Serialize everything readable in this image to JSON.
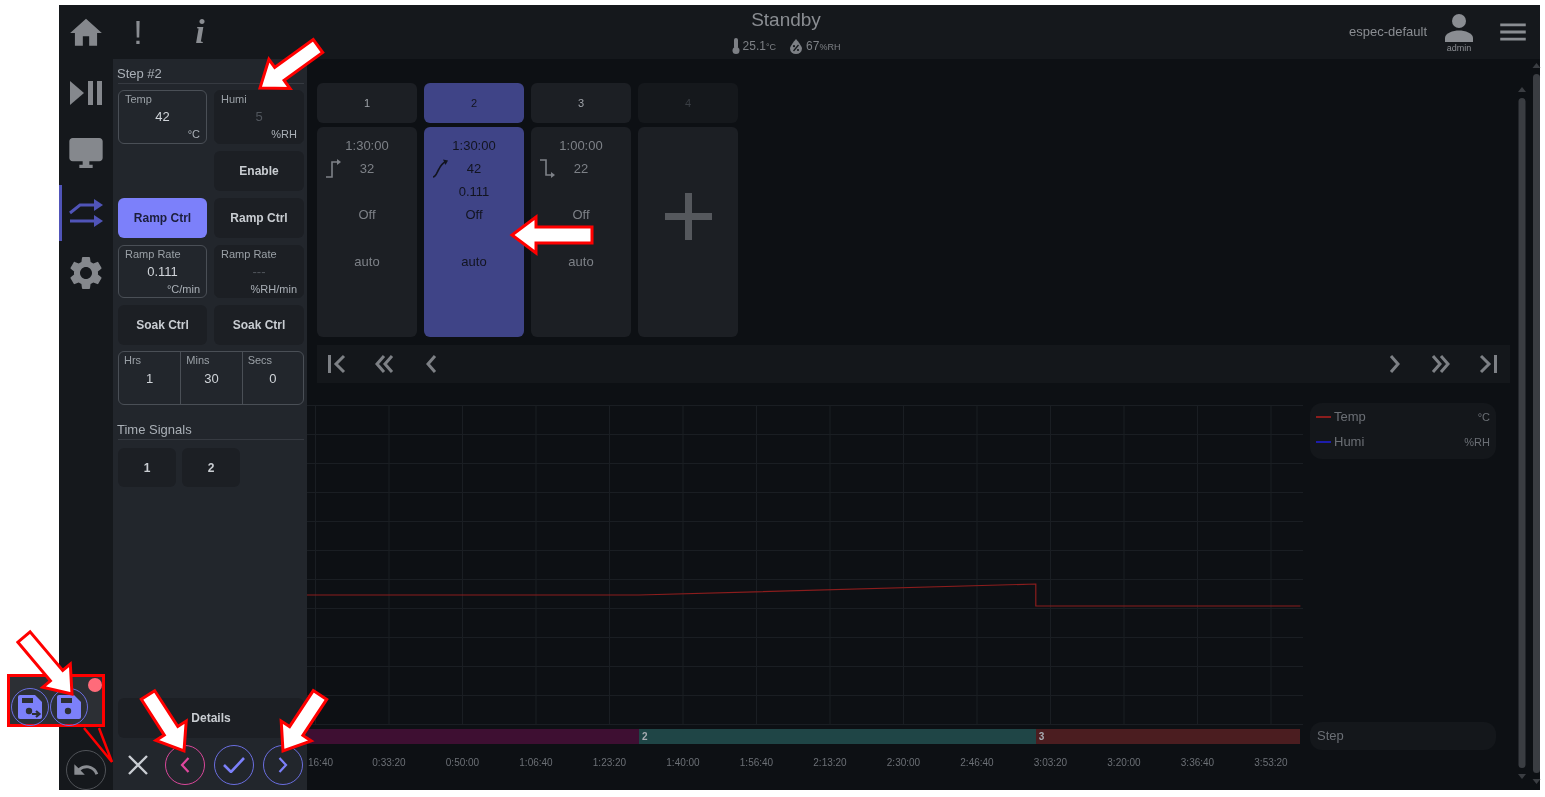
{
  "header": {
    "alerts_icon": "!",
    "info_icon": "i",
    "title": "Standby",
    "temperature": {
      "value": "25.1",
      "unit": "°C"
    },
    "humidity": {
      "value": "67",
      "unit": "%RH"
    },
    "account": "espec-default",
    "user_role": "admin"
  },
  "nav_rail": [
    {
      "selected": false
    },
    {
      "selected": false
    },
    {
      "selected": false
    },
    {
      "selected": true
    },
    {
      "selected": false
    }
  ],
  "step_editor": {
    "title": "Step #2",
    "channels": [
      {
        "enabled": true,
        "setpoint": {
          "label": "Temp",
          "value": "42",
          "unit": "°C"
        },
        "ramp_ctrl": {
          "label": "Ramp Ctrl",
          "selected": true
        },
        "ramp_rate": {
          "label": "Ramp Rate",
          "value": "0.111",
          "unit": "°C/min"
        },
        "soak_ctrl": {
          "label": "Soak Ctrl",
          "selected": false
        }
      },
      {
        "enabled": false,
        "setpoint": {
          "label": "Humi",
          "value": "5",
          "unit": "%RH"
        },
        "enable_button": "Enable",
        "ramp_ctrl": {
          "label": "Ramp Ctrl",
          "selected": false
        },
        "ramp_rate": {
          "label": "Ramp Rate",
          "value": "---",
          "unit": "%RH/min"
        },
        "soak_ctrl": {
          "label": "Soak Ctrl",
          "selected": false
        }
      }
    ],
    "duration": [
      {
        "label": "Hrs",
        "value": "1"
      },
      {
        "label": "Mins",
        "value": "30"
      },
      {
        "label": "Secs",
        "value": "0"
      }
    ],
    "time_signals": {
      "title": "Time Signals",
      "buttons": [
        {
          "label": "1",
          "selected": false
        },
        {
          "label": "2",
          "selected": false
        }
      ]
    },
    "details_button": "Details",
    "footer_buttons": [
      {
        "kind": "cancel",
        "focused": false
      },
      {
        "kind": "previous",
        "focused": true
      },
      {
        "kind": "confirm",
        "focused": false
      },
      {
        "kind": "next",
        "focused": false
      }
    ]
  },
  "step_tabs": [
    {
      "label": "1",
      "selected": false,
      "disabled": false
    },
    {
      "label": "2",
      "selected": true,
      "disabled": false
    },
    {
      "label": "3",
      "selected": false,
      "disabled": false
    },
    {
      "label": "4",
      "selected": false,
      "disabled": true
    }
  ],
  "step_cards": [
    {
      "kind": "step-up",
      "time": "1:30:00",
      "setpoint": "32",
      "status": "Off",
      "mode": "auto",
      "selected": false
    },
    {
      "kind": "ramp-up",
      "time": "1:30:00",
      "setpoint": "42",
      "ramp_rate": "0.111",
      "status": "Off",
      "mode": "auto",
      "selected": true
    },
    {
      "kind": "step-down",
      "time": "1:00:00",
      "setpoint": "22",
      "status": "Off",
      "mode": "auto",
      "selected": false
    }
  ],
  "add_step": true,
  "chart": {
    "legend": [
      {
        "name": "Temp",
        "unit": "°C",
        "color": "#8b1d1d"
      },
      {
        "name": "Humi",
        "unit": "%RH",
        "color": "#1d1dab"
      }
    ],
    "time_axis": [
      "16:40",
      "0:33:20",
      "0:50:00",
      "1:06:40",
      "1:23:20",
      "1:40:00",
      "1:56:40",
      "2:13:20",
      "2:30:00",
      "2:46:40",
      "3:03:20",
      "3:20:00",
      "3:36:40",
      "3:53:20"
    ],
    "step_bar": {
      "label": "Step",
      "segments": [
        {
          "color": "#3e0f32"
        },
        {
          "label": "2",
          "color": "#1f4546"
        },
        {
          "label": "3",
          "color": "#4b1d20"
        }
      ]
    }
  },
  "save_buttons": {
    "notification_dot": true
  }
}
